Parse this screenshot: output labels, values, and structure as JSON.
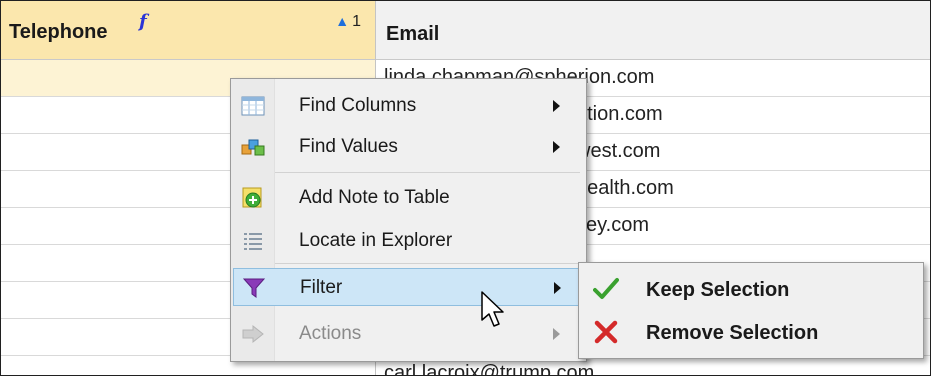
{
  "table": {
    "columns": [
      {
        "label": "Telephone",
        "sorted": true,
        "sort_order": "1",
        "calculated_marker": "f"
      },
      {
        "label": "Email"
      }
    ],
    "email_values": [
      "linda.chapman@spherion.com",
      "ation.com",
      "west.com",
      "health.com",
      "sey.com",
      "",
      "",
      "",
      "carl.lacroix@trump.com"
    ]
  },
  "context_menu": {
    "items": [
      {
        "label": "Find Columns",
        "icon": "table-grid-icon",
        "submenu": true
      },
      {
        "label": "Find Values",
        "icon": "cubes-icon",
        "submenu": true
      },
      {
        "label": "Add Note to Table",
        "icon": "add-note-icon",
        "submenu": false
      },
      {
        "label": "Locate in Explorer",
        "icon": "list-icon",
        "submenu": false
      },
      {
        "label": "Filter",
        "icon": "funnel-icon",
        "submenu": true,
        "highlighted": true
      },
      {
        "label": "Actions",
        "icon": "arrow-right-icon",
        "submenu": true,
        "disabled": true
      }
    ]
  },
  "filter_submenu": {
    "items": [
      {
        "label": "Keep Selection",
        "icon": "checkmark-icon"
      },
      {
        "label": "Remove Selection",
        "icon": "x-mark-icon"
      }
    ]
  },
  "colors": {
    "header_selected_bg": "#fbe7ad",
    "highlight_bg": "#cde6f7",
    "sort_arrow": "#1e6fdc",
    "check": "#3aa12f",
    "cross": "#d42a2a"
  }
}
